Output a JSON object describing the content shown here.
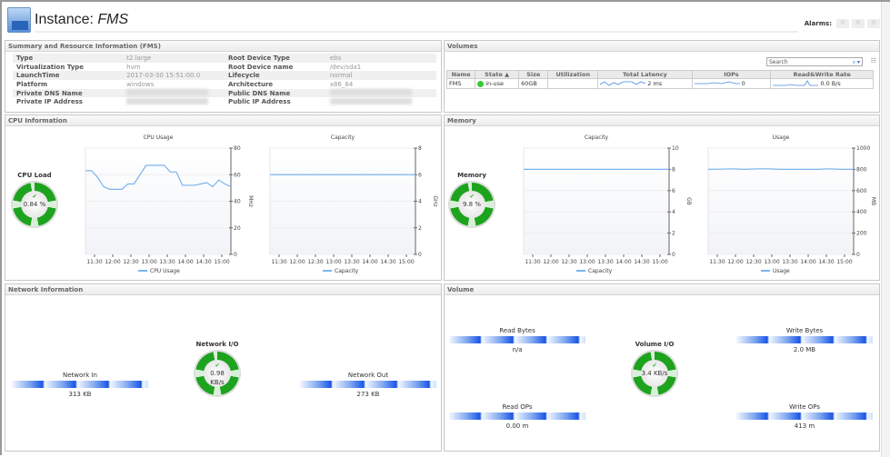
{
  "header": {
    "title_prefix": "Instance: ",
    "title_name": "FMS",
    "alarms_label": "Alarms:",
    "alarm_counts": [
      "0",
      "0",
      "0"
    ]
  },
  "summary": {
    "title": "Summary and Resource Information (FMS)",
    "rows": [
      [
        "Type",
        "t2.large",
        "Root Device Type",
        "ebs"
      ],
      [
        "Virtualization Type",
        "hvm",
        "Root Device name",
        "/dev/sda1"
      ],
      [
        "LaunchTime",
        "2017-03-30 15:51:00.0",
        "Lifecycle",
        "normal"
      ],
      [
        "Platform",
        "windows",
        "Architecture",
        "x86_64"
      ],
      [
        "Private DNS Name",
        "",
        "Public DNS Name",
        ""
      ],
      [
        "Private IP Address",
        "",
        "Public IP Address",
        ""
      ]
    ]
  },
  "volumes": {
    "title": "Volumes",
    "search_placeholder": "Search",
    "columns": [
      "Name",
      "State ▲",
      "Size",
      "Utilization",
      "Total Latency",
      "IOPs",
      "Read&Write Rate"
    ],
    "rows": [
      {
        "name": "FMS",
        "state": "in-use",
        "size": "60GB",
        "utilization": "",
        "latency": "2 ms",
        "iops": "0",
        "rate": "0.0 B/s"
      }
    ]
  },
  "cpu": {
    "title": "CPU Information",
    "gauge_label": "CPU Load",
    "gauge_value": "0.84 %"
  },
  "memory": {
    "title": "Memory",
    "gauge_label": "Memory",
    "gauge_value": "9.8 %"
  },
  "network": {
    "title": "Network Information",
    "gauge_label": "Network I/O",
    "gauge_value": "0.98 KB/s",
    "in_label": "Network In",
    "in_value": "313 KB",
    "out_label": "Network Out",
    "out_value": "273 KB"
  },
  "volume": {
    "title": "Volume",
    "gauge_label": "Volume I/O",
    "gauge_value": "3.4 KB/s",
    "read_bytes_label": "Read Bytes",
    "read_bytes": "n/a",
    "write_bytes_label": "Write Bytes",
    "write_bytes": "2.0 MB",
    "read_ops_label": "Read OPs",
    "read_ops": "0.00 m",
    "write_ops_label": "Write OPs",
    "write_ops": "413 m"
  },
  "chart_data": [
    {
      "id": "cpu-usage",
      "type": "line",
      "title": "CPU Usage",
      "ylabel": "MHz",
      "ylim": [
        0,
        80
      ],
      "yticks": [
        0,
        20,
        40,
        60,
        80
      ],
      "xticks": [
        "11:30",
        "12:00",
        "12:30",
        "13:00",
        "13:30",
        "14:00",
        "14:30",
        "15:00"
      ],
      "xlim": [
        "11:15",
        "15:15"
      ],
      "legend": "bottom",
      "color": "#7ab4f0",
      "series": [
        {
          "name": "CPU Usage",
          "x": [
            "11:15",
            "11:25",
            "11:35",
            "11:45",
            "11:55",
            "12:05",
            "12:15",
            "12:25",
            "12:35",
            "12:45",
            "12:55",
            "13:05",
            "13:15",
            "13:25",
            "13:35",
            "13:45",
            "13:55",
            "14:05",
            "14:15",
            "14:25",
            "14:35",
            "14:45",
            "14:55",
            "15:05",
            "15:15"
          ],
          "y": [
            63,
            63,
            58,
            51,
            49,
            49,
            49,
            53,
            53,
            60,
            67,
            67,
            67,
            67,
            62,
            62,
            52,
            52,
            52,
            53,
            54,
            51,
            56,
            53,
            51
          ]
        }
      ]
    },
    {
      "id": "cpu-capacity",
      "type": "line",
      "title": "Capacity",
      "ylabel": "GHz",
      "ylim": [
        0,
        8
      ],
      "yticks": [
        0,
        2,
        4,
        6,
        8
      ],
      "xticks": [
        "11:30",
        "12:00",
        "12:30",
        "13:00",
        "13:30",
        "14:00",
        "14:30",
        "15:00"
      ],
      "xlim": [
        "11:15",
        "15:15"
      ],
      "legend": "bottom",
      "color": "#7ab4f0",
      "series": [
        {
          "name": "Capacity",
          "x": [
            "11:15",
            "15:15"
          ],
          "y": [
            6,
            6
          ]
        }
      ]
    },
    {
      "id": "mem-capacity",
      "type": "line",
      "title": "Capacity",
      "ylabel": "GB",
      "ylim": [
        0,
        10
      ],
      "yticks": [
        0,
        2,
        4,
        6,
        8,
        10
      ],
      "xticks": [
        "11:30",
        "12:00",
        "12:30",
        "13:00",
        "13:30",
        "14:00",
        "14:30",
        "15:00"
      ],
      "xlim": [
        "11:15",
        "15:15"
      ],
      "legend": "bottom",
      "color": "#7ab4f0",
      "series": [
        {
          "name": "Capacity",
          "x": [
            "11:15",
            "15:15"
          ],
          "y": [
            8,
            8
          ]
        }
      ]
    },
    {
      "id": "mem-usage",
      "type": "line",
      "title": "Usage",
      "ylabel": "MB",
      "ylim": [
        0,
        1000
      ],
      "yticks": [
        0,
        200,
        400,
        600,
        800,
        1000
      ],
      "xticks": [
        "11:30",
        "12:00",
        "12:30",
        "13:00",
        "13:30",
        "14:00",
        "14:30",
        "15:00"
      ],
      "xlim": [
        "11:15",
        "15:15"
      ],
      "legend": "bottom",
      "color": "#7ab4f0",
      "series": [
        {
          "name": "Usage",
          "x": [
            "11:15",
            "11:35",
            "11:55",
            "12:15",
            "12:35",
            "12:55",
            "13:15",
            "13:35",
            "13:55",
            "14:15",
            "14:35",
            "14:55",
            "15:15"
          ],
          "y": [
            800,
            802,
            805,
            800,
            805,
            805,
            800,
            800,
            800,
            800,
            805,
            800,
            800
          ]
        }
      ]
    }
  ]
}
